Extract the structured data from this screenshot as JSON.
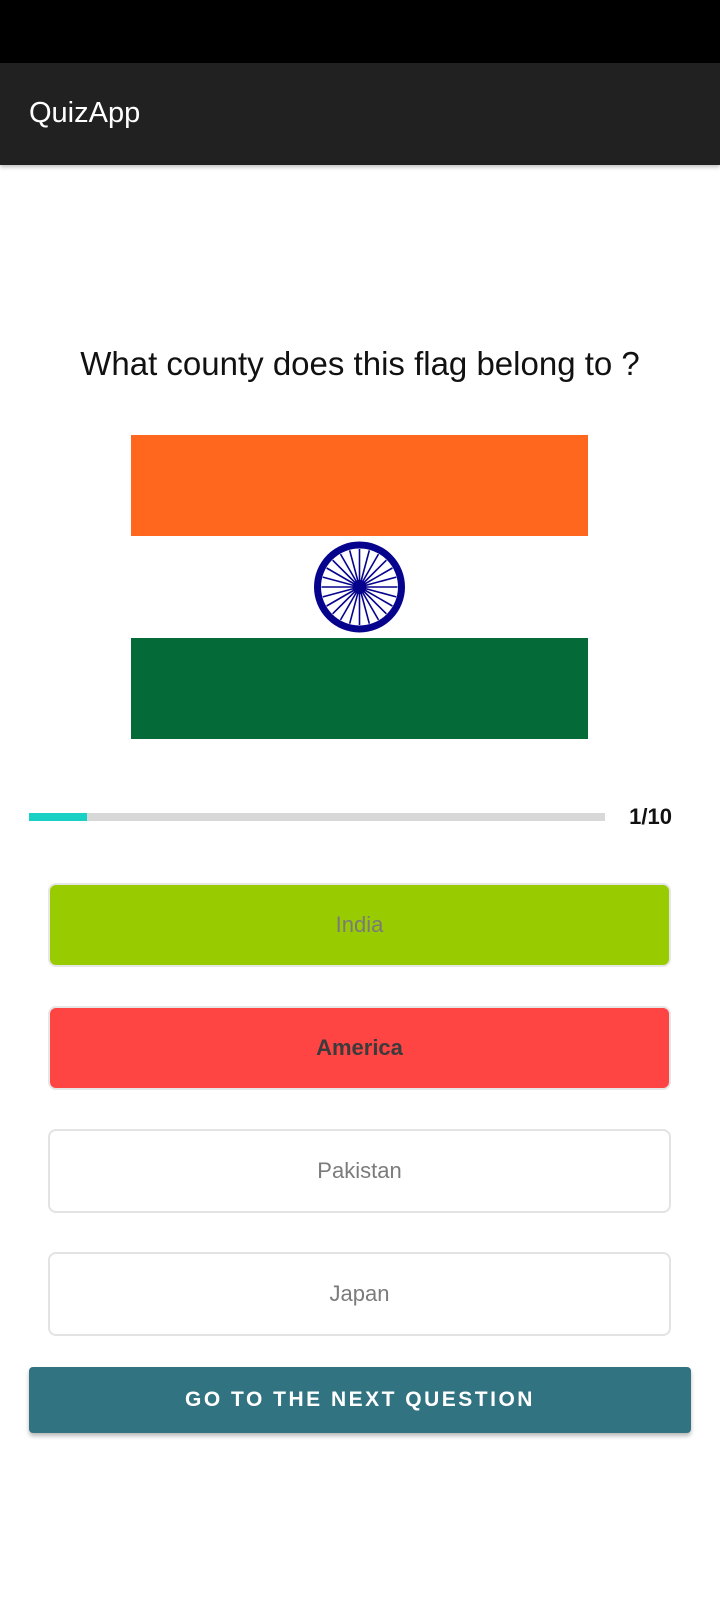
{
  "app_bar": {
    "title": "QuizApp"
  },
  "question": {
    "text": "What county does this flag belong to ?",
    "flag_icon": "india-flag-image",
    "flag_colors": {
      "saffron": "#FF671F",
      "white": "#FFFFFF",
      "green": "#046A38",
      "chakra": "#06038D"
    }
  },
  "progress": {
    "current": 1,
    "total": 10,
    "label": "1/10",
    "fill_color": "#18D1C4",
    "track_color": "#D8D8D8"
  },
  "options": [
    {
      "label": "India",
      "state": "correct",
      "color": "#99CC00"
    },
    {
      "label": "America",
      "state": "wrong",
      "color": "#FF4444"
    },
    {
      "label": "Pakistan",
      "state": "default",
      "color": "#FFFFFF"
    },
    {
      "label": "Japan",
      "state": "default",
      "color": "#FFFFFF"
    }
  ],
  "actions": {
    "next_label": "GO TO THE NEXT QUESTION",
    "next_color": "#317380"
  }
}
